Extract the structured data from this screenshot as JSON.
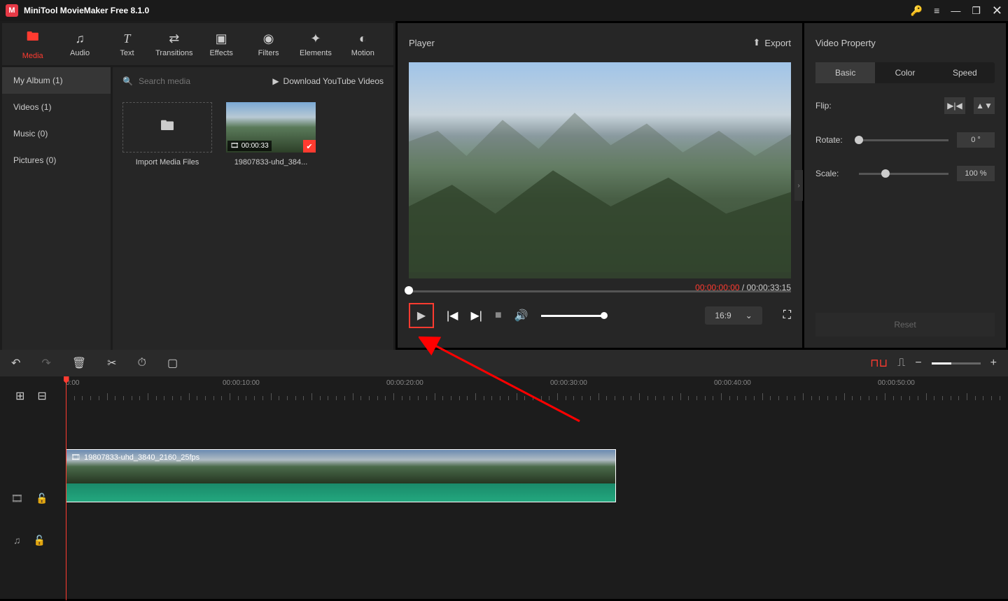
{
  "app": {
    "title": "MiniTool MovieMaker Free 8.1.0"
  },
  "tabs": [
    {
      "id": "media",
      "label": "Media"
    },
    {
      "id": "audio",
      "label": "Audio"
    },
    {
      "id": "text",
      "label": "Text"
    },
    {
      "id": "transitions",
      "label": "Transitions"
    },
    {
      "id": "effects",
      "label": "Effects"
    },
    {
      "id": "filters",
      "label": "Filters"
    },
    {
      "id": "elements",
      "label": "Elements"
    },
    {
      "id": "motion",
      "label": "Motion"
    }
  ],
  "sidebar": {
    "items": [
      {
        "label": "My Album (1)",
        "active": true
      },
      {
        "label": "Videos (1)"
      },
      {
        "label": "Music (0)"
      },
      {
        "label": "Pictures (0)"
      }
    ]
  },
  "search": {
    "placeholder": "Search media"
  },
  "download_label": "Download YouTube Videos",
  "media": {
    "import_label": "Import Media Files",
    "clip": {
      "duration": "00:00:33",
      "name": "19807833-uhd_384..."
    }
  },
  "player": {
    "title": "Player",
    "export_label": "Export",
    "time_current": "00:00:00:00",
    "time_total": "00:00:33:15",
    "aspect": "16:9"
  },
  "video_property": {
    "title": "Video Property",
    "tabs": [
      "Basic",
      "Color",
      "Speed"
    ],
    "flip_label": "Flip:",
    "rotate_label": "Rotate:",
    "rotate_value": "0 °",
    "scale_label": "Scale:",
    "scale_value": "100 %",
    "reset_label": "Reset"
  },
  "timeline": {
    "ruler": [
      "0:00",
      "00:00:10:00",
      "00:00:20:00",
      "00:00:30:00",
      "00:00:40:00",
      "00:00:50:00"
    ],
    "clip_name": "19807833-uhd_3840_2160_25fps"
  }
}
